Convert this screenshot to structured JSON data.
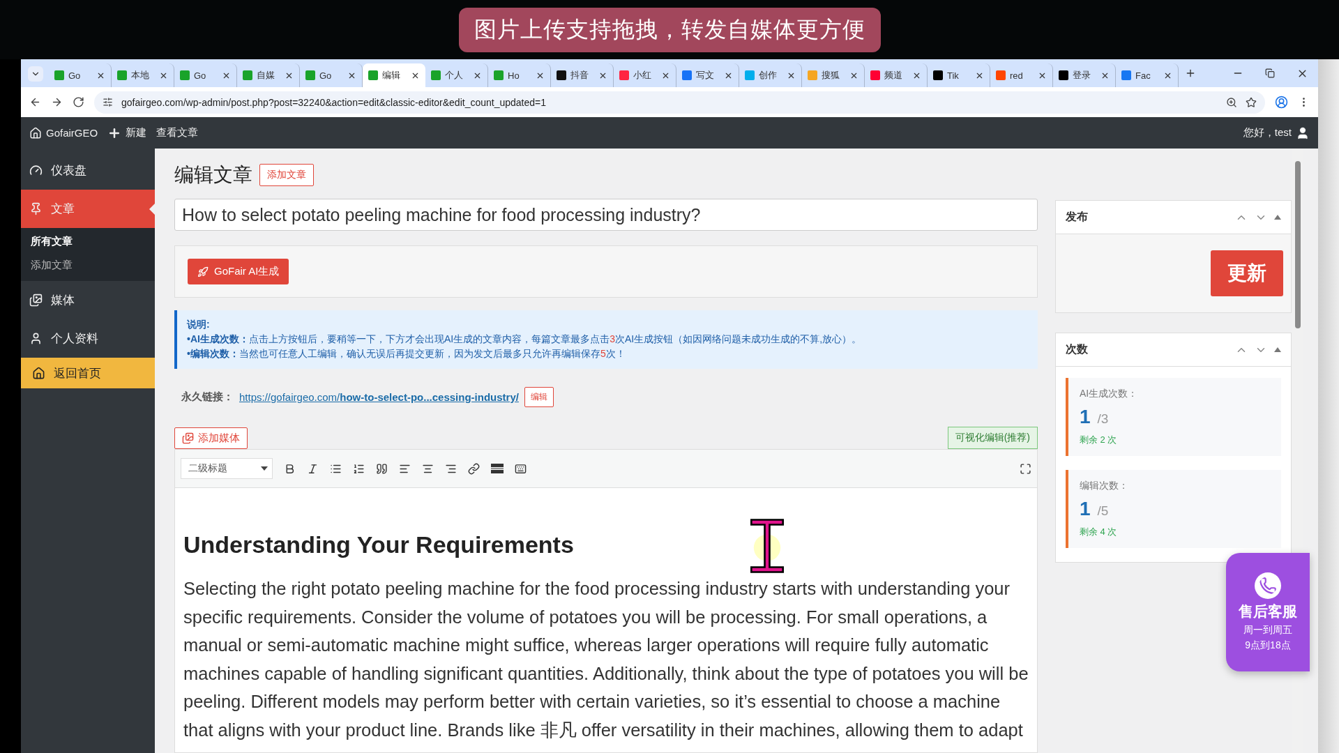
{
  "caption": "图片上传支持拖拽，转发自媒体更方便",
  "browser": {
    "tabs": [
      {
        "label": "Go",
        "color": "#1aa32a",
        "selected": false
      },
      {
        "label": "本地",
        "color": "#1aa32a",
        "selected": false
      },
      {
        "label": "Go",
        "color": "#1aa32a",
        "selected": false
      },
      {
        "label": "自媒",
        "color": "#1aa32a",
        "selected": false
      },
      {
        "label": "Go",
        "color": "#1aa32a",
        "selected": false
      },
      {
        "label": "编辑",
        "color": "#1aa32a",
        "selected": true
      },
      {
        "label": "个人",
        "color": "#1aa32a",
        "selected": false
      },
      {
        "label": "Ho",
        "color": "#1aa32a",
        "selected": false
      },
      {
        "label": "抖音",
        "color": "#111111",
        "selected": false
      },
      {
        "label": "小红",
        "color": "#ff2442",
        "selected": false
      },
      {
        "label": "写文",
        "color": "#1772f6",
        "selected": false
      },
      {
        "label": "创作",
        "color": "#00aeec",
        "selected": false
      },
      {
        "label": "搜狐",
        "color": "#f5a623",
        "selected": false
      },
      {
        "label": "频道",
        "color": "#ff0033",
        "selected": false
      },
      {
        "label": "Tik",
        "color": "#000000",
        "selected": false
      },
      {
        "label": "red",
        "color": "#ff4500",
        "selected": false
      },
      {
        "label": "登录",
        "color": "#000000",
        "selected": false
      },
      {
        "label": "Fac",
        "color": "#1877f2",
        "selected": false
      }
    ],
    "url": "gofairgeo.com/wp-admin/post.php?post=32240&action=edit&classic-editor&edit_count_updated=1"
  },
  "admin_bar": {
    "site": "GofairGEO",
    "new": "新建",
    "view": "查看文章",
    "greeting": "您好，test"
  },
  "sidebar": {
    "items": [
      {
        "label": "仪表盘",
        "kind": "dashboard",
        "selected": false
      },
      {
        "label": "文章",
        "kind": "posts",
        "selected": true,
        "children": [
          {
            "label": "所有文章",
            "selected": true
          },
          {
            "label": "添加文章",
            "selected": false
          }
        ]
      },
      {
        "label": "媒体",
        "kind": "media",
        "selected": false
      },
      {
        "label": "个人资料",
        "kind": "profile",
        "selected": false
      },
      {
        "label": "返回首页",
        "kind": "home",
        "selected": false
      }
    ]
  },
  "page": {
    "heading": "编辑文章",
    "add_button": "添加文章",
    "title": "How to select potato peeling machine for food processing industry?",
    "ai_button": "GoFair AI生成",
    "notice": {
      "heading": "说明:",
      "lines": [
        {
          "label": "•AI生成次数：",
          "before": "点击上方按钮后，要稍等一下，下方才会出现AI生成的文章内容，每篇文章最多点击",
          "number": "3",
          "after": "次AI生成按钮（如因网络问题未成功生成的不算,放心）。"
        },
        {
          "label": "•编辑次数：",
          "before": "当然也可任意人工编辑，确认无误后再提交更新，因为发文后最多只允许再编辑保存",
          "number": "5",
          "after": "次！"
        }
      ]
    },
    "permalink": {
      "label": "永久链接：",
      "url": "https://gofairgeo.com/**how-to-select-po...cessing-industry/**",
      "edit": "编辑"
    },
    "add_media": "添加媒体",
    "editor_tab": "可视化编辑(推荐)",
    "format": "二级标题",
    "content": {
      "heading": "Understanding Your Requirements",
      "paragraph": "Selecting the right potato peeling machine for the food processing industry starts with understanding your specific requirements. Consider the volume of potatoes you will be processing. For small operations, a manual or semi-automatic machine might suffice, whereas larger operations will require fully automatic machines capable of handling significant quantities. Additionally, think about the type of potatoes you will be peeling. Different models may perform better with certain varieties, so it’s essential to choose a machine that aligns with your product line. Brands like 非凡 offer versatility in their machines, allowing them to adapt"
    }
  },
  "publish_panel": {
    "title": "发布",
    "button": "更新"
  },
  "counts_panel": {
    "title": "次数",
    "items": [
      {
        "label": "AI生成次数：",
        "used": "1",
        "total": "/3",
        "remaining": "剩余 2 次"
      },
      {
        "label": "编辑次数：",
        "used": "1",
        "total": "/5",
        "remaining": "剩余 4 次"
      }
    ]
  },
  "support_widget": {
    "title": "售后客服",
    "hours": [
      "周一到周五",
      "9点到18点"
    ]
  }
}
